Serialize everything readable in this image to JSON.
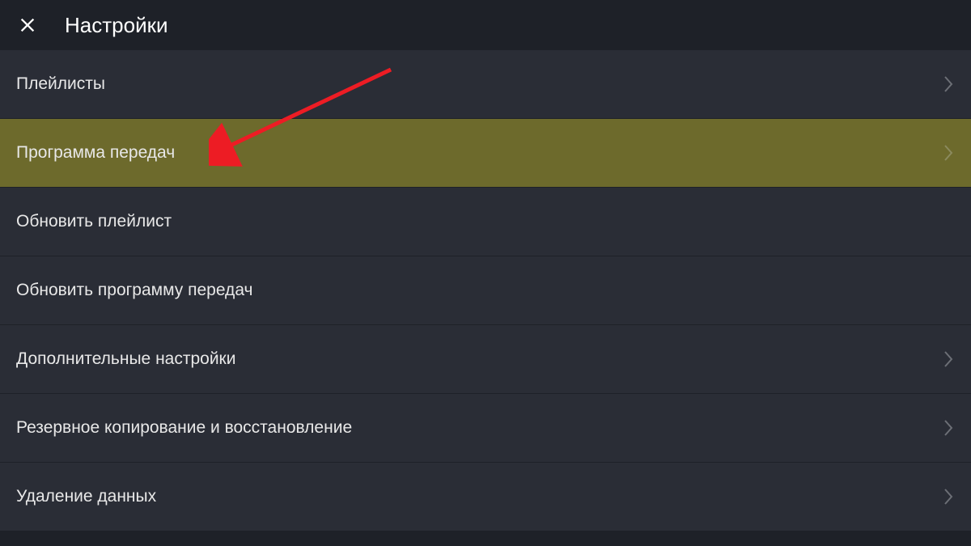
{
  "header": {
    "title": "Настройки"
  },
  "menu": {
    "items": [
      {
        "label": "Плейлисты",
        "highlighted": false,
        "hasChevron": true
      },
      {
        "label": "Программа передач",
        "highlighted": true,
        "hasChevron": true
      },
      {
        "label": "Обновить плейлист",
        "highlighted": false,
        "hasChevron": false
      },
      {
        "label": "Обновить программу передач",
        "highlighted": false,
        "hasChevron": false
      },
      {
        "label": "Дополнительные настройки",
        "highlighted": false,
        "hasChevron": true
      },
      {
        "label": "Резервное копирование и восстановление",
        "highlighted": false,
        "hasChevron": true
      },
      {
        "label": "Удаление данных",
        "highlighted": false,
        "hasChevron": true
      }
    ]
  },
  "colors": {
    "background": "#1e2128",
    "itemBackground": "#2a2d36",
    "highlightBackground": "#6d6a2c",
    "text": "#e8e8e8",
    "chevron": "#6c6f76",
    "arrow": "#ed1c24"
  }
}
